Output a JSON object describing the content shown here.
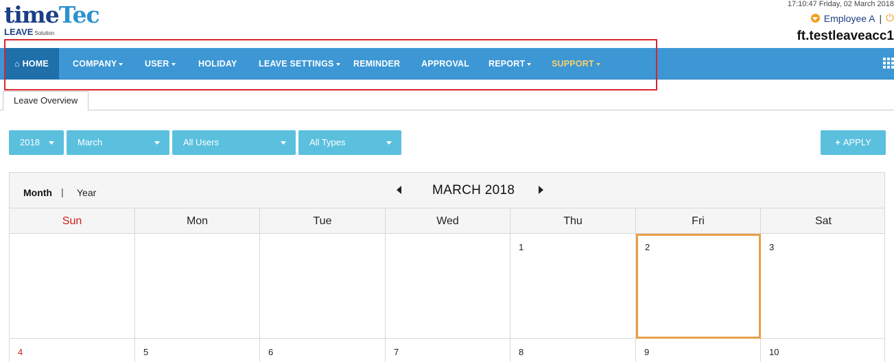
{
  "header": {
    "logo_part1": "time",
    "logo_part2": "Tec",
    "logo_sub": "LEAVE",
    "logo_sub_small": "Solution",
    "datetime": "17:10:47 Friday, 02 March 2018",
    "user_name": "Employee A",
    "separator": "|",
    "account": "ft.testleaveacc1"
  },
  "nav": {
    "items": [
      {
        "label": "HOME",
        "icon": "home-icon"
      },
      {
        "label": "COMPANY",
        "dropdown": true
      },
      {
        "label": "USER",
        "dropdown": true
      },
      {
        "label": "HOLIDAY"
      },
      {
        "label": "LEAVE SETTINGS",
        "dropdown": true
      },
      {
        "label": "REMINDER"
      },
      {
        "label": "APPROVAL"
      },
      {
        "label": "REPORT",
        "dropdown": true
      },
      {
        "label": "SUPPORT",
        "dropdown": true
      }
    ],
    "bar_color": "#3c97d4",
    "active_color": "#1e6faa",
    "support_color": "#f7d070"
  },
  "tabs": {
    "active": "Leave Overview"
  },
  "filters": {
    "year": "2018",
    "month": "March",
    "users": "All Users",
    "types": "All Types",
    "apply_label": "APPLY"
  },
  "calendar": {
    "view_month": "Month",
    "view_separator": "|",
    "view_year": "Year",
    "title": "MARCH 2018",
    "days": [
      "Sun",
      "Mon",
      "Tue",
      "Wed",
      "Thu",
      "Fri",
      "Sat"
    ],
    "week1": [
      "",
      "",
      "",
      "",
      "1",
      "2",
      "3"
    ],
    "week2": [
      "4",
      "5",
      "6",
      "7",
      "8",
      "9",
      "10"
    ],
    "today": "2",
    "today_color": "#e8a04a",
    "sunday_color": "#d11a1a"
  }
}
